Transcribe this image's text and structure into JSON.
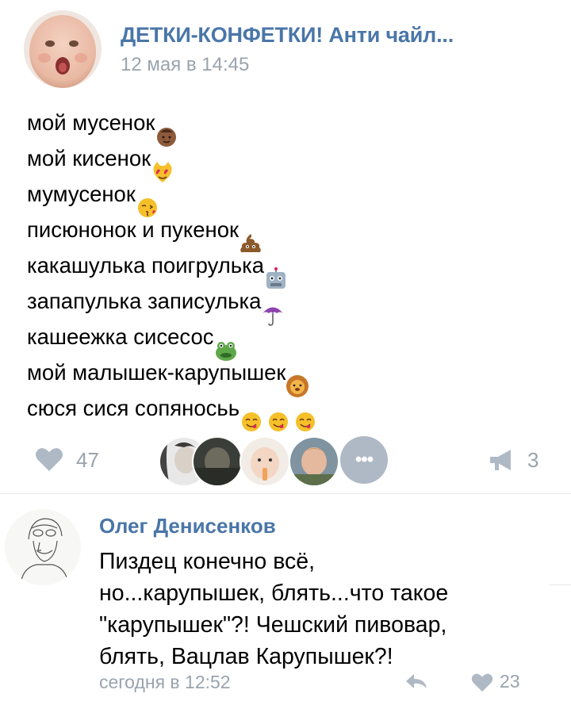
{
  "post": {
    "group_name": "ДЕТКИ-КОНФЕТКИ! Анти чайл...",
    "date": "12 мая в 14:45",
    "lines": [
      {
        "text": "мой мусенок",
        "emojis": [
          "baby-face"
        ]
      },
      {
        "text": "мой кисенок",
        "emojis": [
          "heart-eyes-cat"
        ]
      },
      {
        "text": "мумусенок",
        "emojis": [
          "kissing-face"
        ]
      },
      {
        "text": "писюнонок и пукенок",
        "emojis": [
          "poop"
        ]
      },
      {
        "text": "какашулька поигрулька",
        "emojis": [
          "robot"
        ]
      },
      {
        "text": "запапулька записулька",
        "emojis": [
          "umbrella"
        ]
      },
      {
        "text": "кашеежка сисесос",
        "emojis": [
          "frog"
        ]
      },
      {
        "text": "мой малышек-карупышек",
        "emojis": [
          "lion"
        ]
      },
      {
        "text": "сюся сися сопяносьь",
        "emojis": [
          "yum-face",
          "yum-face",
          "yum-face"
        ]
      }
    ]
  },
  "actions": {
    "likes": "47",
    "more_label": "•••",
    "shares": "3",
    "likers": [
      "liker-1",
      "liker-2",
      "liker-3",
      "liker-4"
    ]
  },
  "comment": {
    "author": "Олег Денисенков",
    "lines": [
      "Пиздец конечно всё,",
      "но...карупышек, блять...что такое",
      "\"карупышек\"?! Чешский пивовар,",
      "блять, Вацлав Карупышек?!"
    ],
    "date": "сегодня в 12:52",
    "likes": "23"
  },
  "colors": {
    "accent": "#4a76a8",
    "muted": "#9aa3ad",
    "icon": "#aeb9c5"
  }
}
